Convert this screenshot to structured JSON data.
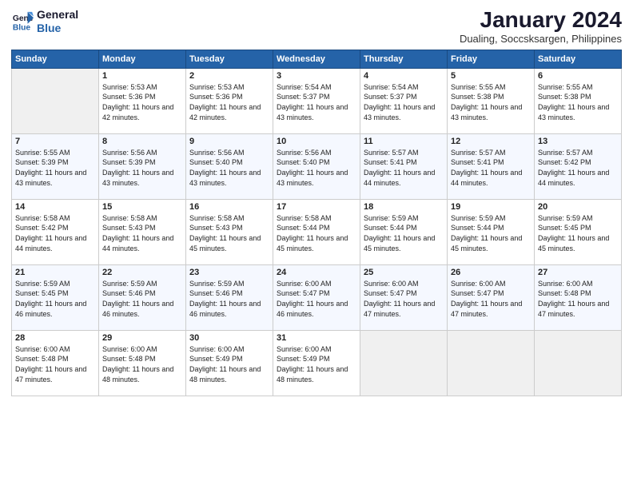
{
  "header": {
    "logo_line1": "General",
    "logo_line2": "Blue",
    "title": "January 2024",
    "subtitle": "Dualing, Soccsksargen, Philippines"
  },
  "days_of_week": [
    "Sunday",
    "Monday",
    "Tuesday",
    "Wednesday",
    "Thursday",
    "Friday",
    "Saturday"
  ],
  "weeks": [
    [
      {
        "day": "",
        "empty": true
      },
      {
        "day": "1",
        "sunrise": "5:53 AM",
        "sunset": "5:36 PM",
        "daylight": "11 hours and 42 minutes."
      },
      {
        "day": "2",
        "sunrise": "5:53 AM",
        "sunset": "5:36 PM",
        "daylight": "11 hours and 42 minutes."
      },
      {
        "day": "3",
        "sunrise": "5:54 AM",
        "sunset": "5:37 PM",
        "daylight": "11 hours and 43 minutes."
      },
      {
        "day": "4",
        "sunrise": "5:54 AM",
        "sunset": "5:37 PM",
        "daylight": "11 hours and 43 minutes."
      },
      {
        "day": "5",
        "sunrise": "5:55 AM",
        "sunset": "5:38 PM",
        "daylight": "11 hours and 43 minutes."
      },
      {
        "day": "6",
        "sunrise": "5:55 AM",
        "sunset": "5:38 PM",
        "daylight": "11 hours and 43 minutes."
      }
    ],
    [
      {
        "day": "7",
        "sunrise": "5:55 AM",
        "sunset": "5:39 PM",
        "daylight": "11 hours and 43 minutes."
      },
      {
        "day": "8",
        "sunrise": "5:56 AM",
        "sunset": "5:39 PM",
        "daylight": "11 hours and 43 minutes."
      },
      {
        "day": "9",
        "sunrise": "5:56 AM",
        "sunset": "5:40 PM",
        "daylight": "11 hours and 43 minutes."
      },
      {
        "day": "10",
        "sunrise": "5:56 AM",
        "sunset": "5:40 PM",
        "daylight": "11 hours and 43 minutes."
      },
      {
        "day": "11",
        "sunrise": "5:57 AM",
        "sunset": "5:41 PM",
        "daylight": "11 hours and 44 minutes."
      },
      {
        "day": "12",
        "sunrise": "5:57 AM",
        "sunset": "5:41 PM",
        "daylight": "11 hours and 44 minutes."
      },
      {
        "day": "13",
        "sunrise": "5:57 AM",
        "sunset": "5:42 PM",
        "daylight": "11 hours and 44 minutes."
      }
    ],
    [
      {
        "day": "14",
        "sunrise": "5:58 AM",
        "sunset": "5:42 PM",
        "daylight": "11 hours and 44 minutes."
      },
      {
        "day": "15",
        "sunrise": "5:58 AM",
        "sunset": "5:43 PM",
        "daylight": "11 hours and 44 minutes."
      },
      {
        "day": "16",
        "sunrise": "5:58 AM",
        "sunset": "5:43 PM",
        "daylight": "11 hours and 45 minutes."
      },
      {
        "day": "17",
        "sunrise": "5:58 AM",
        "sunset": "5:44 PM",
        "daylight": "11 hours and 45 minutes."
      },
      {
        "day": "18",
        "sunrise": "5:59 AM",
        "sunset": "5:44 PM",
        "daylight": "11 hours and 45 minutes."
      },
      {
        "day": "19",
        "sunrise": "5:59 AM",
        "sunset": "5:44 PM",
        "daylight": "11 hours and 45 minutes."
      },
      {
        "day": "20",
        "sunrise": "5:59 AM",
        "sunset": "5:45 PM",
        "daylight": "11 hours and 45 minutes."
      }
    ],
    [
      {
        "day": "21",
        "sunrise": "5:59 AM",
        "sunset": "5:45 PM",
        "daylight": "11 hours and 46 minutes."
      },
      {
        "day": "22",
        "sunrise": "5:59 AM",
        "sunset": "5:46 PM",
        "daylight": "11 hours and 46 minutes."
      },
      {
        "day": "23",
        "sunrise": "5:59 AM",
        "sunset": "5:46 PM",
        "daylight": "11 hours and 46 minutes."
      },
      {
        "day": "24",
        "sunrise": "6:00 AM",
        "sunset": "5:47 PM",
        "daylight": "11 hours and 46 minutes."
      },
      {
        "day": "25",
        "sunrise": "6:00 AM",
        "sunset": "5:47 PM",
        "daylight": "11 hours and 47 minutes."
      },
      {
        "day": "26",
        "sunrise": "6:00 AM",
        "sunset": "5:47 PM",
        "daylight": "11 hours and 47 minutes."
      },
      {
        "day": "27",
        "sunrise": "6:00 AM",
        "sunset": "5:48 PM",
        "daylight": "11 hours and 47 minutes."
      }
    ],
    [
      {
        "day": "28",
        "sunrise": "6:00 AM",
        "sunset": "5:48 PM",
        "daylight": "11 hours and 47 minutes."
      },
      {
        "day": "29",
        "sunrise": "6:00 AM",
        "sunset": "5:48 PM",
        "daylight": "11 hours and 48 minutes."
      },
      {
        "day": "30",
        "sunrise": "6:00 AM",
        "sunset": "5:49 PM",
        "daylight": "11 hours and 48 minutes."
      },
      {
        "day": "31",
        "sunrise": "6:00 AM",
        "sunset": "5:49 PM",
        "daylight": "11 hours and 48 minutes."
      },
      {
        "day": "",
        "empty": true
      },
      {
        "day": "",
        "empty": true
      },
      {
        "day": "",
        "empty": true
      }
    ]
  ],
  "labels": {
    "sunrise": "Sunrise:",
    "sunset": "Sunset:",
    "daylight": "Daylight:"
  }
}
